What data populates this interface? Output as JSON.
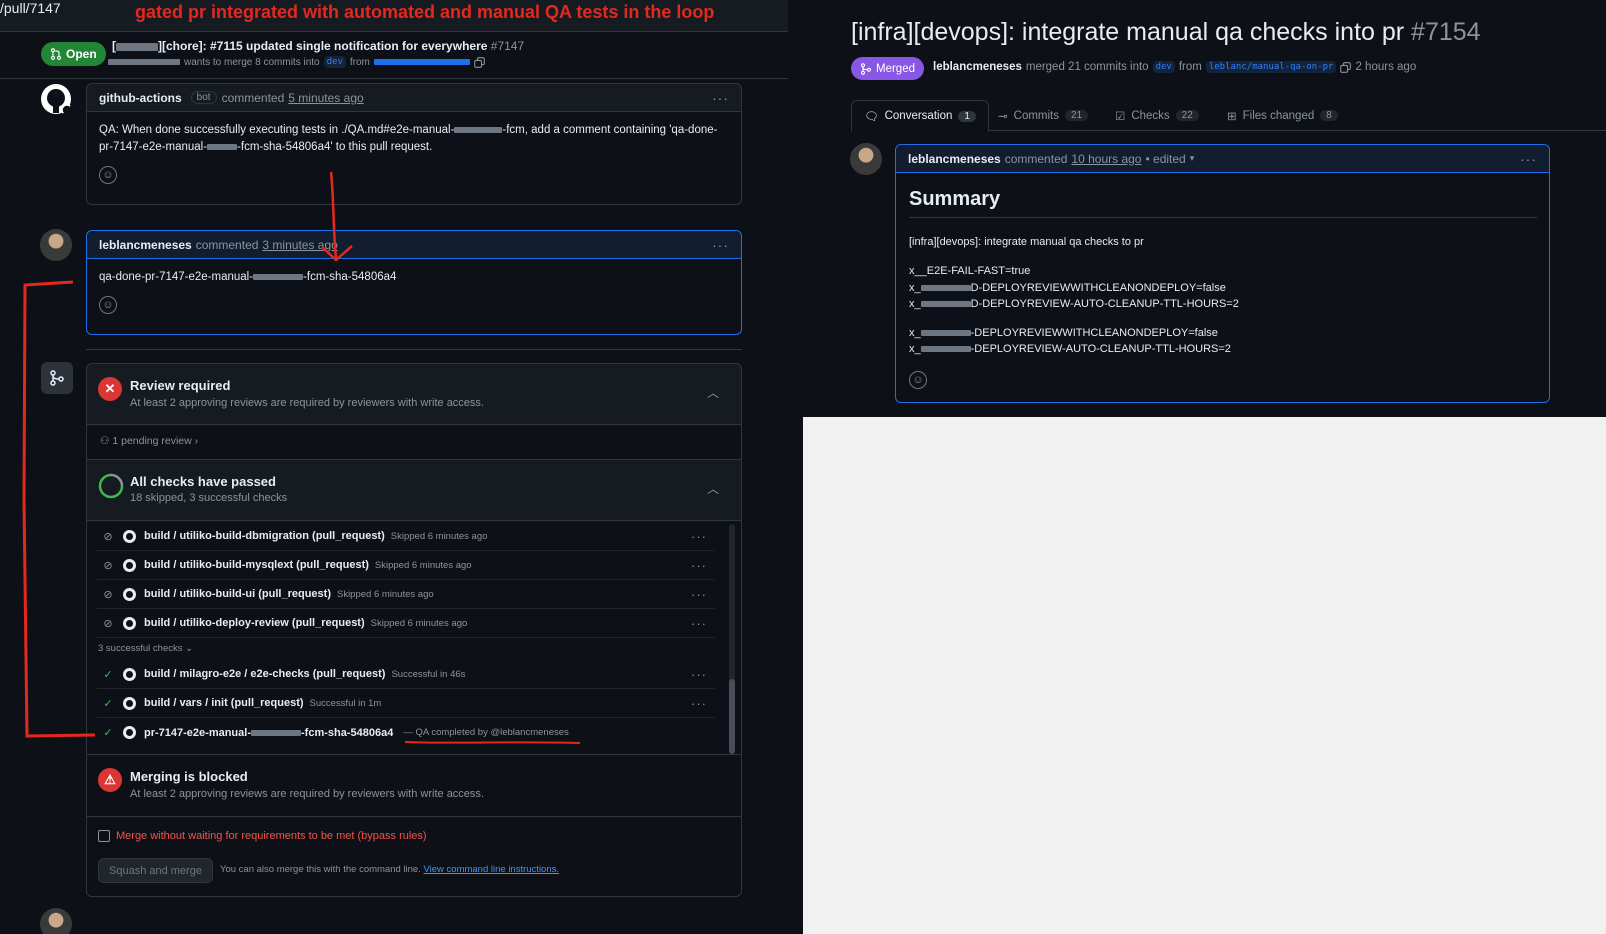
{
  "annotation": {
    "title": "gated pr integrated with automated and manual QA tests in the loop",
    "underline_color": "#e5281e"
  },
  "left": {
    "url_fragment": "/pull/7147",
    "pr": {
      "state": "Open",
      "title_prefix": "[",
      "title_text": "][chore]: #7115 updated single notification for everywhere",
      "number": "#7147",
      "sub_merge": "wants to merge 8 commits into",
      "base_branch": "dev",
      "from": "from"
    },
    "comments": [
      {
        "author": "github-actions",
        "badge": "bot",
        "action": "commented",
        "time": "5 minutes ago",
        "body_1": "QA: When done successfully executing tests in ./QA.md#e2e-manual-",
        "body_2": "-fcm, add a comment containing 'qa-done-",
        "body_3": "pr-7147-e2e-manual-",
        "body_4": "-fcm-sha-54806a4' to this pull request."
      },
      {
        "author": "leblancmeneses",
        "action": "commented",
        "time": "3 minutes ago",
        "body_1": "qa-done-pr-7147-e2e-manual-",
        "body_2": "-fcm-sha-54806a4"
      }
    ],
    "merge": {
      "review_title": "Review required",
      "review_sub": "At least 2 approving reviews are required by reviewers with write access.",
      "pending": "1 pending review",
      "checks_title": "All checks have passed",
      "checks_sub": "18 skipped, 3 successful checks",
      "skipped_checks": [
        {
          "name": "build / utiliko-build-dbmigration (pull_request)",
          "desc": "Skipped 6 minutes ago"
        },
        {
          "name": "build / utiliko-build-mysqlext (pull_request)",
          "desc": "Skipped 6 minutes ago"
        },
        {
          "name": "build / utiliko-build-ui (pull_request)",
          "desc": "Skipped 6 minutes ago"
        },
        {
          "name": "build / utiliko-deploy-review (pull_request)",
          "desc": "Skipped 6 minutes ago"
        }
      ],
      "successful_label": "3 successful checks",
      "successful_checks": [
        {
          "name": "build / milagro-e2e / e2e-checks (pull_request)",
          "desc": "Successful in 46s"
        },
        {
          "name": "build / vars / init (pull_request)",
          "desc": "Successful in 1m"
        }
      ],
      "manual_check": {
        "name_1": "pr-7147-e2e-manual-",
        "name_2": "-fcm-sha-54806a4",
        "desc": "— QA completed by @leblancmeneses"
      },
      "blocked_title": "Merging is blocked",
      "blocked_sub": "At least 2 approving reviews are required by reviewers with write access.",
      "bypass_label": "Merge without waiting for requirements to be met (bypass rules)",
      "squash_label": "Squash and merge",
      "cli_text": "You can also merge this with the command line.",
      "cli_link": "View command line instructions."
    }
  },
  "right": {
    "title": "[infra][devops]: integrate manual qa checks into pr",
    "number": "#7154",
    "state": "Merged",
    "author": "leblancmeneses",
    "merged_text": "merged 21 commits into",
    "base_branch": "dev",
    "from": "from",
    "head_branch": "leblanc/manual-qa-on-pr",
    "time": "2 hours ago",
    "tabs": [
      {
        "label": "Conversation",
        "count": "1"
      },
      {
        "label": "Commits",
        "count": "21"
      },
      {
        "label": "Checks",
        "count": "22"
      },
      {
        "label": "Files changed",
        "count": "8"
      }
    ],
    "comment": {
      "author": "leblancmeneses",
      "action": "commented",
      "time": "10 hours ago",
      "edited": "• edited",
      "heading": "Summary",
      "line_1": "[infra][devops]: integrate manual qa checks to pr",
      "line_2": "x__E2E-FAIL-FAST=true",
      "line_3_a": "x_",
      "line_3_b": "D-DEPLOYREVIEWWITHCLEANONDEPLOY=false",
      "line_4_a": "x_",
      "line_4_b": "D-DEPLOYREVIEW-AUTO-CLEANUP-TTL-HOURS=2",
      "line_5_a": "x_",
      "line_5_b": "-DEPLOYREVIEWWITHCLEANONDEPLOY=false",
      "line_6_a": "x_",
      "line_6_b": "-DEPLOYREVIEW-AUTO-CLEANUP-TTL-HOURS=2"
    }
  }
}
